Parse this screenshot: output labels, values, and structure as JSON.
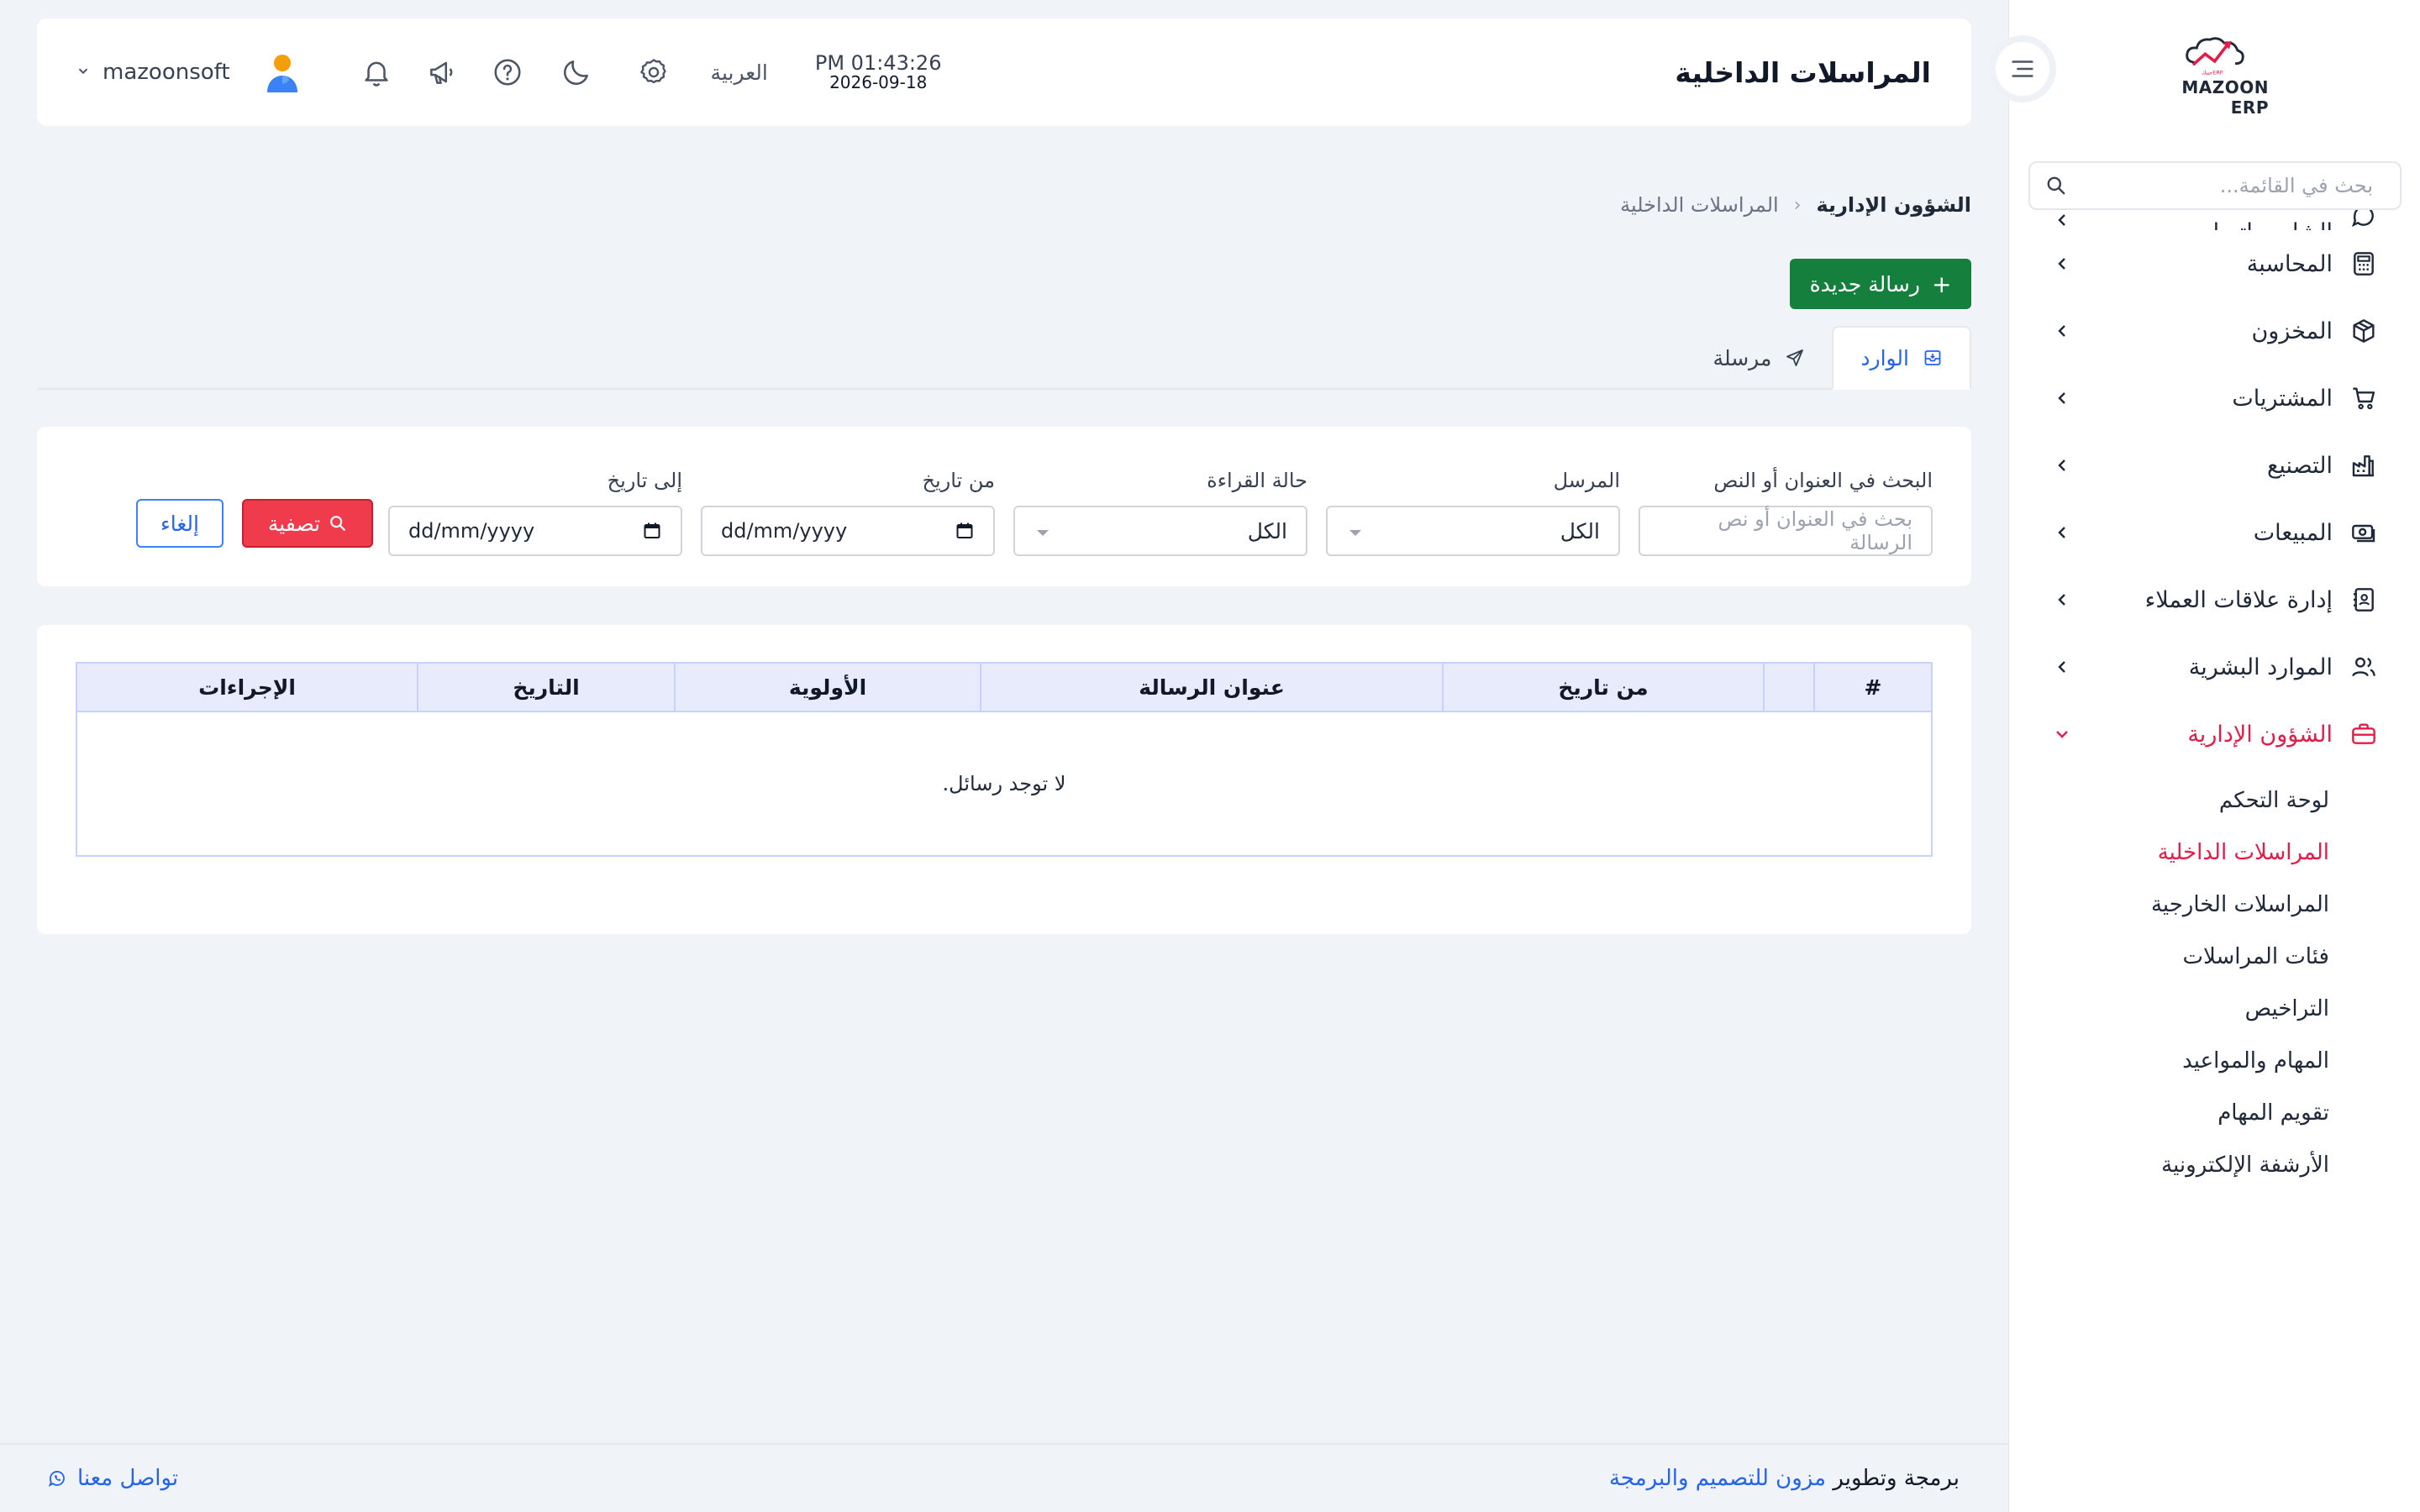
{
  "sidebar": {
    "logo_text": "MAZOON ERP",
    "search_placeholder": "بحث في القائمة...",
    "partial_item": "الشات واتساب",
    "items": [
      {
        "label": "المحاسبة",
        "icon": "calculator-icon"
      },
      {
        "label": "المخزون",
        "icon": "box-icon"
      },
      {
        "label": "المشتريات",
        "icon": "cart-icon"
      },
      {
        "label": "التصنيع",
        "icon": "factory-icon"
      },
      {
        "label": "المبيعات",
        "icon": "cash-icon"
      },
      {
        "label": "إدارة علاقات العملاء",
        "icon": "contacts-book-icon"
      },
      {
        "label": "الموارد البشرية",
        "icon": "users-icon"
      },
      {
        "label": "الشؤون الإدارية",
        "icon": "briefcase-icon",
        "active": true
      }
    ],
    "subitems": [
      {
        "label": "لوحة التحكم"
      },
      {
        "label": "المراسلات الداخلية",
        "active": true
      },
      {
        "label": "المراسلات الخارجية"
      },
      {
        "label": "فئات المراسلات"
      },
      {
        "label": "التراخيص"
      },
      {
        "label": "المهام والمواعيد"
      },
      {
        "label": "تقويم المهام"
      },
      {
        "label": "الأرشفة الإلكترونية"
      }
    ]
  },
  "header": {
    "title": "المراسلات الداخلية",
    "time": "PM 01:43:26",
    "date": "2026-09-18",
    "language": "العربية",
    "username": "mazoonsoft"
  },
  "breadcrumb": {
    "root": "الشؤون الإدارية",
    "separator": "‹",
    "current": "المراسلات الداخلية"
  },
  "actions": {
    "new_message": "رسالة جديدة",
    "plus": "+"
  },
  "tabs": [
    {
      "label": "الوارد",
      "active": true
    },
    {
      "label": "مرسلة",
      "active": false
    }
  ],
  "filters": {
    "search_label": "البحث في العنوان أو النص",
    "search_placeholder": "بحث في العنوان أو نص الرسالة",
    "sender_label": "المرسل",
    "sender_value": "الكل",
    "read_status_label": "حالة القراءة",
    "read_status_value": "الكل",
    "from_date_label": "من تاريخ",
    "from_date_value": "dd/mm/yyyy",
    "to_date_label": "إلى تاريخ",
    "to_date_value": "dd/mm/yyyy",
    "filter_button": "تصفية",
    "cancel_button": "إلغاء"
  },
  "table": {
    "columns": [
      "#",
      "",
      "من تاريخ",
      "عنوان الرسالة",
      "الأولوية",
      "التاريخ",
      "الإجراءات"
    ],
    "empty_message": "لا توجد رسائل."
  },
  "footer": {
    "credit_prefix": "برمجة وتطوير",
    "credit_brand": "مزون للتصميم والبرمجة",
    "contact": "تواصل معنا"
  },
  "colors": {
    "accent_green": "#15803d",
    "accent_red": "#ef3b4b",
    "active_menu": "#e11d48",
    "link_blue": "#2563eb"
  }
}
